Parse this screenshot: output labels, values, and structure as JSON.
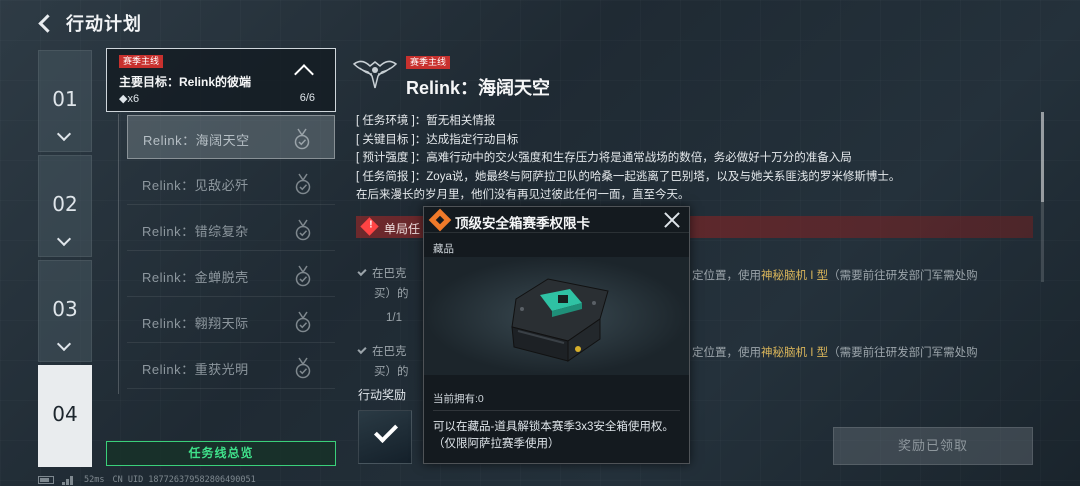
{
  "header": {
    "title": "行动计划"
  },
  "stages": [
    {
      "num": "01",
      "active": false
    },
    {
      "num": "02",
      "active": false
    },
    {
      "num": "03",
      "active": false
    },
    {
      "num": "04",
      "active": true
    }
  ],
  "task_group": {
    "tag": "赛季主线",
    "main_goal": "主要目标：Relink的彼端",
    "count": "◆x6",
    "progress": "6/6"
  },
  "tasks": [
    {
      "label": "Relink：海阔天空",
      "selected": true
    },
    {
      "label": "Relink：见敌必歼",
      "selected": false
    },
    {
      "label": "Relink：错综复杂",
      "selected": false
    },
    {
      "label": "Relink：金蝉脱壳",
      "selected": false
    },
    {
      "label": "Relink：翱翔天际",
      "selected": false
    },
    {
      "label": "Relink：重获光明",
      "selected": false
    }
  ],
  "summary_button": "任务线总览",
  "detail": {
    "tag": "赛季主线",
    "title": "Relink：海阔天空",
    "lines": [
      "[ 任务环境 ]：暂无相关情报",
      "[ 关键目标 ]：达成指定行动目标",
      "[ 预计强度 ]：高难行动中的交火强度和生存压力将是通常战场的数倍，务必做好十万分的准备入局",
      "[ 任务简报 ]：Zoya说，她最终与阿萨拉卫队的哈桑一起逃离了巴别塔，以及与她关系匪浅的罗米修斯博士。",
      "在后来漫长的岁月里，他们没有再见过彼此任何一面，直至今天。"
    ],
    "alert": "单局任",
    "objective1": {
      "prefix": "在巴克",
      "line2": "买）的",
      "progress": "1/1",
      "right_text": "定位置，使用",
      "highlight": "神秘脑机 I 型",
      "right_tail": "（需要前往研发部门军需处购"
    },
    "objective2": {
      "prefix": "在巴克",
      "line2": "买）的",
      "right_text": "定位置，使用",
      "highlight": "神秘脑机 I 型",
      "right_tail": "（需要前往研发部门军需处购"
    },
    "reward_label": "行动奖励",
    "claimed_button": "奖励已领取"
  },
  "popup": {
    "title": "顶级安全箱赛季权限卡",
    "category": "藏品",
    "owned": "当前拥有:0",
    "description": "可以在藏品-道具解锁本赛季3x3安全箱使用权。（仅限阿萨拉赛季使用）"
  },
  "footer": {
    "latency": "52ms",
    "uid": "CN UID 18772637958280649005​1"
  },
  "colors": {
    "season_tag": "#c8312e",
    "summary_green": "#3fe08a",
    "highlight_gold": "#d8b45a",
    "popup_icon": "#f07a2a"
  }
}
